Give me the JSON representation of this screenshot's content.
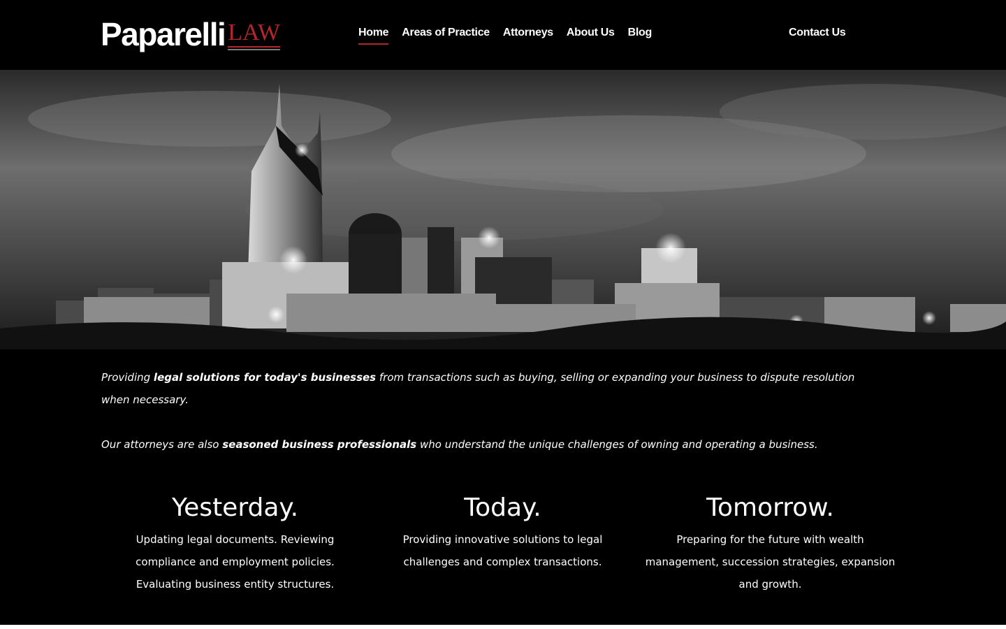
{
  "header": {
    "logo_name": "Paparelli",
    "logo_law": "LAW",
    "nav": [
      "Home",
      "Areas of Practice",
      "Attorneys",
      "About Us",
      "Blog"
    ],
    "active_nav": "Home",
    "contact": "Contact Us"
  },
  "hero": {
    "image_description": "black-and-white night city skyline"
  },
  "intro": {
    "p1_pre": "Providing ",
    "p1_bold": "legal solutions for today's businesses",
    "p1_post": " from transactions such as buying, selling or expanding your business to dispute resolution when necessary.",
    "p2_pre": "Our attorneys are also ",
    "p2_bold": "seasoned business professionals",
    "p2_post": " who understand the unique challenges of owning and operating a business."
  },
  "columns": [
    {
      "title": "Yesterday.",
      "text": "Updating legal documents. Reviewing compliance and employment policies. Evaluating business entity structures."
    },
    {
      "title": "Today.",
      "text": "Providing innovative solutions to legal challenges and complex transactions."
    },
    {
      "title": "Tomorrow.",
      "text": "Preparing for the future with wealth management, succession strategies, expansion and growth."
    }
  ],
  "colors": {
    "accent": "#b3262b",
    "background": "#000000",
    "text": "#ffffff"
  }
}
